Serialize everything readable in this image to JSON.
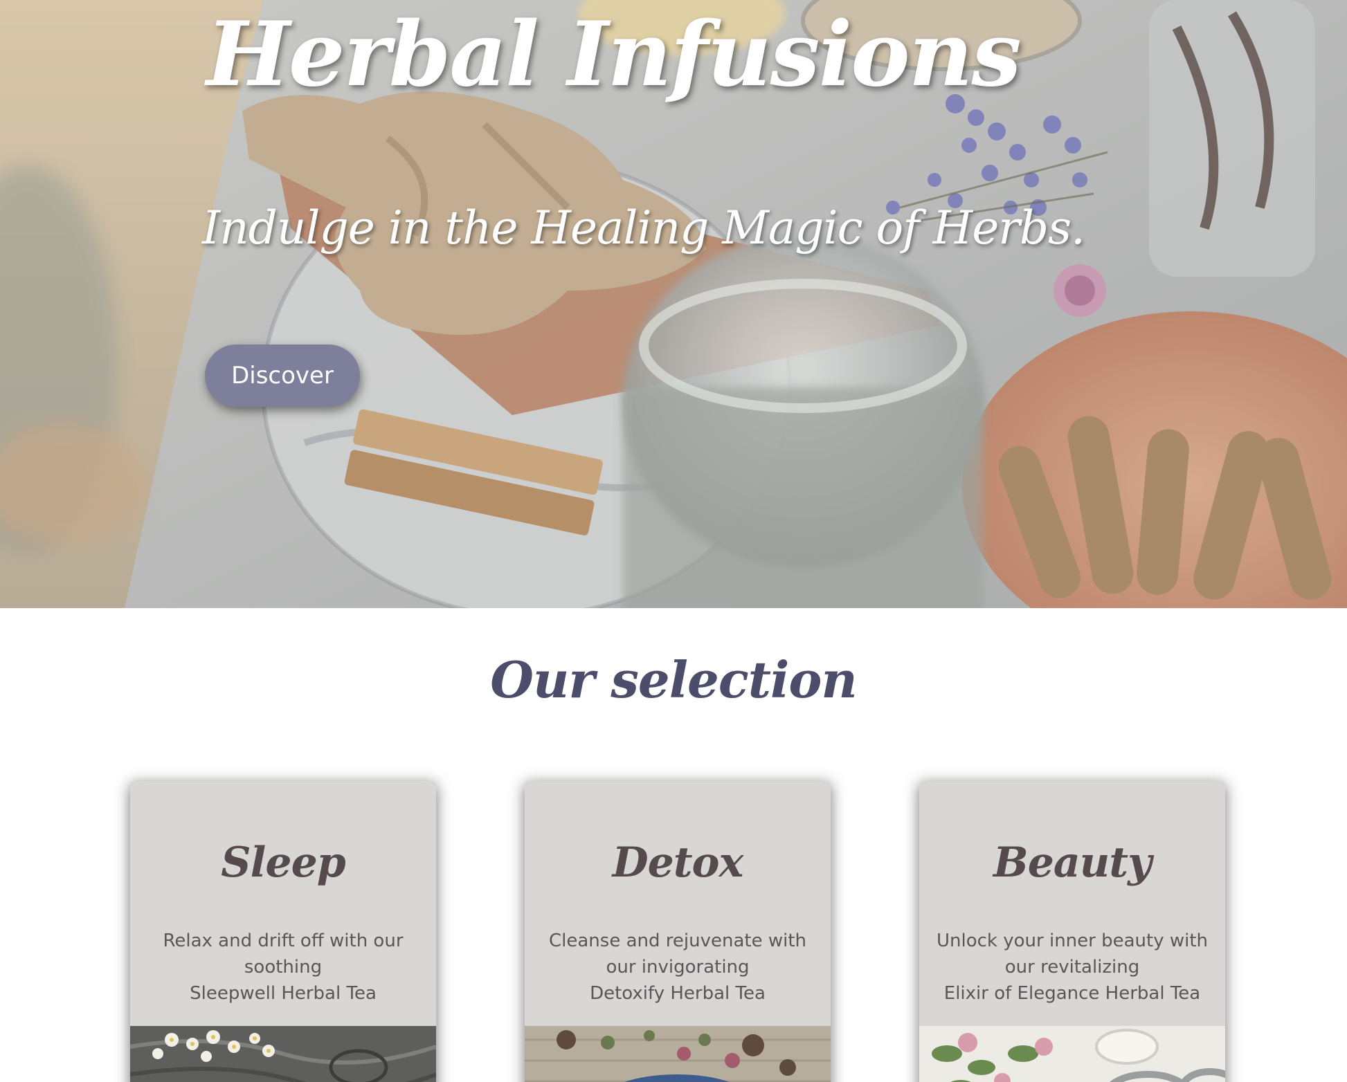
{
  "hero": {
    "title": "Herbal Infusions",
    "subtitle": "Indulge in the Healing Magic of Herbs.",
    "button_label": "Discover",
    "button_color": "#7e7f9b"
  },
  "selection": {
    "title": "Our selection",
    "title_color": "#4c4d6a",
    "cards": [
      {
        "title": "Sleep",
        "description_line1": "Relax and drift off with our",
        "description_line2": "soothing",
        "description_line3": "Sleepwell Herbal Tea"
      },
      {
        "title": "Detox",
        "description_line1": "Cleanse and rejuvenate with",
        "description_line2": "our invigorating",
        "description_line3": "Detoxify Herbal Tea"
      },
      {
        "title": "Beauty",
        "description_line1": "Unlock your inner beauty with",
        "description_line2": "our revitalizing",
        "description_line3": "Elixir of Elegance Herbal Tea"
      }
    ],
    "card_background": "#d9d7d4"
  }
}
